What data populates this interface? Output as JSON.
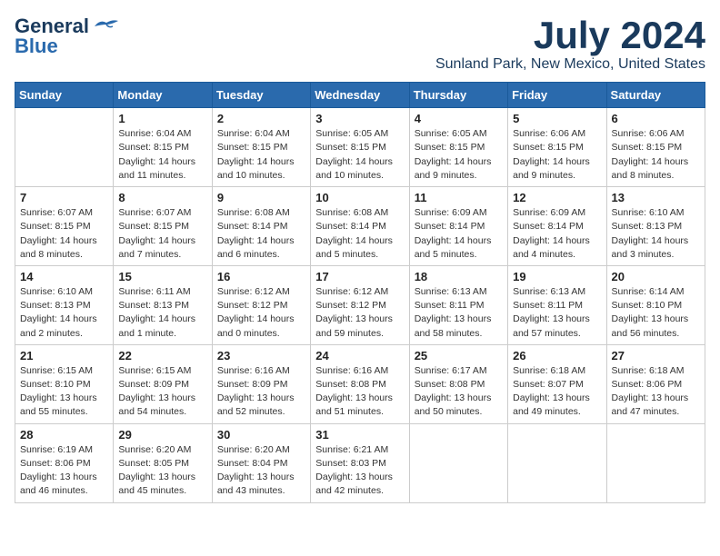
{
  "header": {
    "logo_line1": "General",
    "logo_line2": "Blue",
    "title": "July 2024",
    "subtitle": "Sunland Park, New Mexico, United States"
  },
  "columns": [
    "Sunday",
    "Monday",
    "Tuesday",
    "Wednesday",
    "Thursday",
    "Friday",
    "Saturday"
  ],
  "weeks": [
    [
      {
        "day": "",
        "sunrise": "",
        "sunset": "",
        "daylight": ""
      },
      {
        "day": "1",
        "sunrise": "Sunrise: 6:04 AM",
        "sunset": "Sunset: 8:15 PM",
        "daylight": "Daylight: 14 hours and 11 minutes."
      },
      {
        "day": "2",
        "sunrise": "Sunrise: 6:04 AM",
        "sunset": "Sunset: 8:15 PM",
        "daylight": "Daylight: 14 hours and 10 minutes."
      },
      {
        "day": "3",
        "sunrise": "Sunrise: 6:05 AM",
        "sunset": "Sunset: 8:15 PM",
        "daylight": "Daylight: 14 hours and 10 minutes."
      },
      {
        "day": "4",
        "sunrise": "Sunrise: 6:05 AM",
        "sunset": "Sunset: 8:15 PM",
        "daylight": "Daylight: 14 hours and 9 minutes."
      },
      {
        "day": "5",
        "sunrise": "Sunrise: 6:06 AM",
        "sunset": "Sunset: 8:15 PM",
        "daylight": "Daylight: 14 hours and 9 minutes."
      },
      {
        "day": "6",
        "sunrise": "Sunrise: 6:06 AM",
        "sunset": "Sunset: 8:15 PM",
        "daylight": "Daylight: 14 hours and 8 minutes."
      }
    ],
    [
      {
        "day": "7",
        "sunrise": "Sunrise: 6:07 AM",
        "sunset": "Sunset: 8:15 PM",
        "daylight": "Daylight: 14 hours and 8 minutes."
      },
      {
        "day": "8",
        "sunrise": "Sunrise: 6:07 AM",
        "sunset": "Sunset: 8:15 PM",
        "daylight": "Daylight: 14 hours and 7 minutes."
      },
      {
        "day": "9",
        "sunrise": "Sunrise: 6:08 AM",
        "sunset": "Sunset: 8:14 PM",
        "daylight": "Daylight: 14 hours and 6 minutes."
      },
      {
        "day": "10",
        "sunrise": "Sunrise: 6:08 AM",
        "sunset": "Sunset: 8:14 PM",
        "daylight": "Daylight: 14 hours and 5 minutes."
      },
      {
        "day": "11",
        "sunrise": "Sunrise: 6:09 AM",
        "sunset": "Sunset: 8:14 PM",
        "daylight": "Daylight: 14 hours and 5 minutes."
      },
      {
        "day": "12",
        "sunrise": "Sunrise: 6:09 AM",
        "sunset": "Sunset: 8:14 PM",
        "daylight": "Daylight: 14 hours and 4 minutes."
      },
      {
        "day": "13",
        "sunrise": "Sunrise: 6:10 AM",
        "sunset": "Sunset: 8:13 PM",
        "daylight": "Daylight: 14 hours and 3 minutes."
      }
    ],
    [
      {
        "day": "14",
        "sunrise": "Sunrise: 6:10 AM",
        "sunset": "Sunset: 8:13 PM",
        "daylight": "Daylight: 14 hours and 2 minutes."
      },
      {
        "day": "15",
        "sunrise": "Sunrise: 6:11 AM",
        "sunset": "Sunset: 8:13 PM",
        "daylight": "Daylight: 14 hours and 1 minute."
      },
      {
        "day": "16",
        "sunrise": "Sunrise: 6:12 AM",
        "sunset": "Sunset: 8:12 PM",
        "daylight": "Daylight: 14 hours and 0 minutes."
      },
      {
        "day": "17",
        "sunrise": "Sunrise: 6:12 AM",
        "sunset": "Sunset: 8:12 PM",
        "daylight": "Daylight: 13 hours and 59 minutes."
      },
      {
        "day": "18",
        "sunrise": "Sunrise: 6:13 AM",
        "sunset": "Sunset: 8:11 PM",
        "daylight": "Daylight: 13 hours and 58 minutes."
      },
      {
        "day": "19",
        "sunrise": "Sunrise: 6:13 AM",
        "sunset": "Sunset: 8:11 PM",
        "daylight": "Daylight: 13 hours and 57 minutes."
      },
      {
        "day": "20",
        "sunrise": "Sunrise: 6:14 AM",
        "sunset": "Sunset: 8:10 PM",
        "daylight": "Daylight: 13 hours and 56 minutes."
      }
    ],
    [
      {
        "day": "21",
        "sunrise": "Sunrise: 6:15 AM",
        "sunset": "Sunset: 8:10 PM",
        "daylight": "Daylight: 13 hours and 55 minutes."
      },
      {
        "day": "22",
        "sunrise": "Sunrise: 6:15 AM",
        "sunset": "Sunset: 8:09 PM",
        "daylight": "Daylight: 13 hours and 54 minutes."
      },
      {
        "day": "23",
        "sunrise": "Sunrise: 6:16 AM",
        "sunset": "Sunset: 8:09 PM",
        "daylight": "Daylight: 13 hours and 52 minutes."
      },
      {
        "day": "24",
        "sunrise": "Sunrise: 6:16 AM",
        "sunset": "Sunset: 8:08 PM",
        "daylight": "Daylight: 13 hours and 51 minutes."
      },
      {
        "day": "25",
        "sunrise": "Sunrise: 6:17 AM",
        "sunset": "Sunset: 8:08 PM",
        "daylight": "Daylight: 13 hours and 50 minutes."
      },
      {
        "day": "26",
        "sunrise": "Sunrise: 6:18 AM",
        "sunset": "Sunset: 8:07 PM",
        "daylight": "Daylight: 13 hours and 49 minutes."
      },
      {
        "day": "27",
        "sunrise": "Sunrise: 6:18 AM",
        "sunset": "Sunset: 8:06 PM",
        "daylight": "Daylight: 13 hours and 47 minutes."
      }
    ],
    [
      {
        "day": "28",
        "sunrise": "Sunrise: 6:19 AM",
        "sunset": "Sunset: 8:06 PM",
        "daylight": "Daylight: 13 hours and 46 minutes."
      },
      {
        "day": "29",
        "sunrise": "Sunrise: 6:20 AM",
        "sunset": "Sunset: 8:05 PM",
        "daylight": "Daylight: 13 hours and 45 minutes."
      },
      {
        "day": "30",
        "sunrise": "Sunrise: 6:20 AM",
        "sunset": "Sunset: 8:04 PM",
        "daylight": "Daylight: 13 hours and 43 minutes."
      },
      {
        "day": "31",
        "sunrise": "Sunrise: 6:21 AM",
        "sunset": "Sunset: 8:03 PM",
        "daylight": "Daylight: 13 hours and 42 minutes."
      },
      {
        "day": "",
        "sunrise": "",
        "sunset": "",
        "daylight": ""
      },
      {
        "day": "",
        "sunrise": "",
        "sunset": "",
        "daylight": ""
      },
      {
        "day": "",
        "sunrise": "",
        "sunset": "",
        "daylight": ""
      }
    ]
  ]
}
